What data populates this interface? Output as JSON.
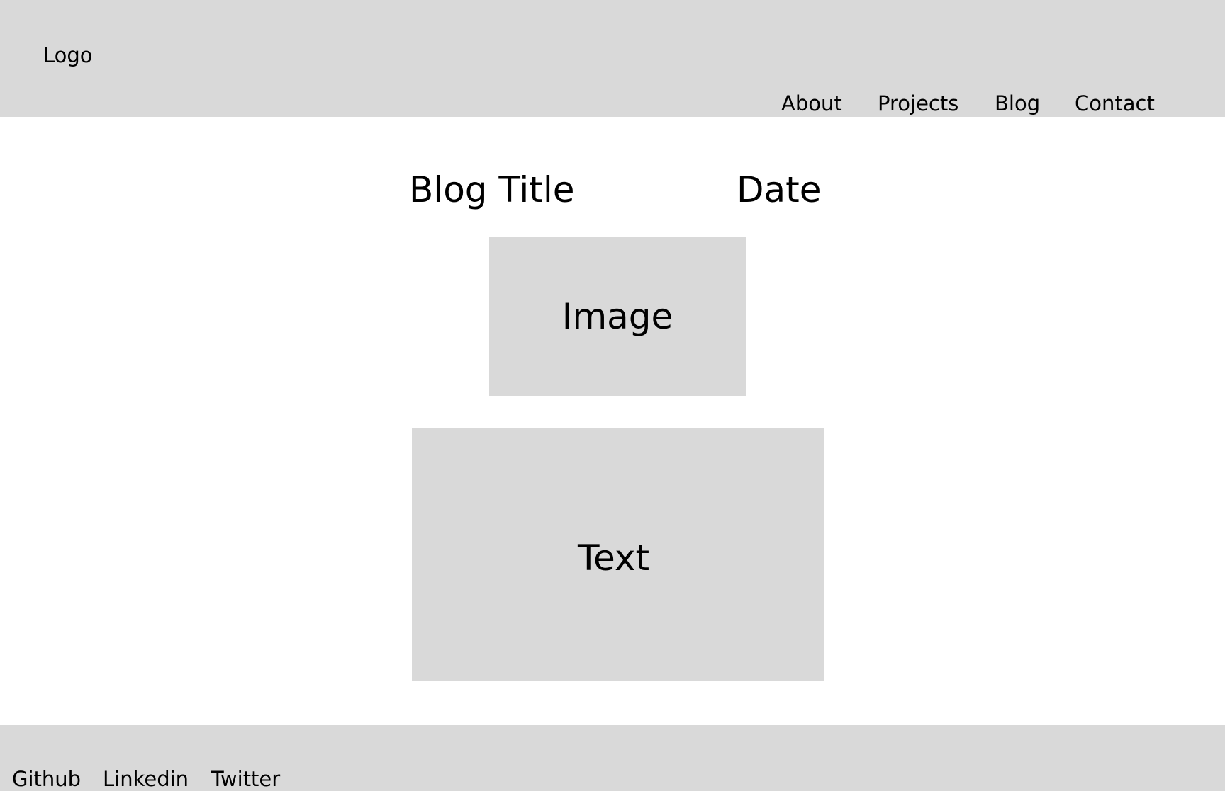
{
  "header": {
    "logo": "Logo",
    "nav": [
      "About",
      "Projects",
      "Blog",
      "Contact"
    ]
  },
  "post": {
    "title": "Blog Title",
    "date": "Date",
    "image_label": "Image",
    "text_label": "Text"
  },
  "footer": {
    "links": [
      "Github",
      "Linkedin",
      "Twitter"
    ]
  },
  "colors": {
    "placeholder": "#d9d9d9",
    "background": "#ffffff",
    "text": "#000000"
  }
}
